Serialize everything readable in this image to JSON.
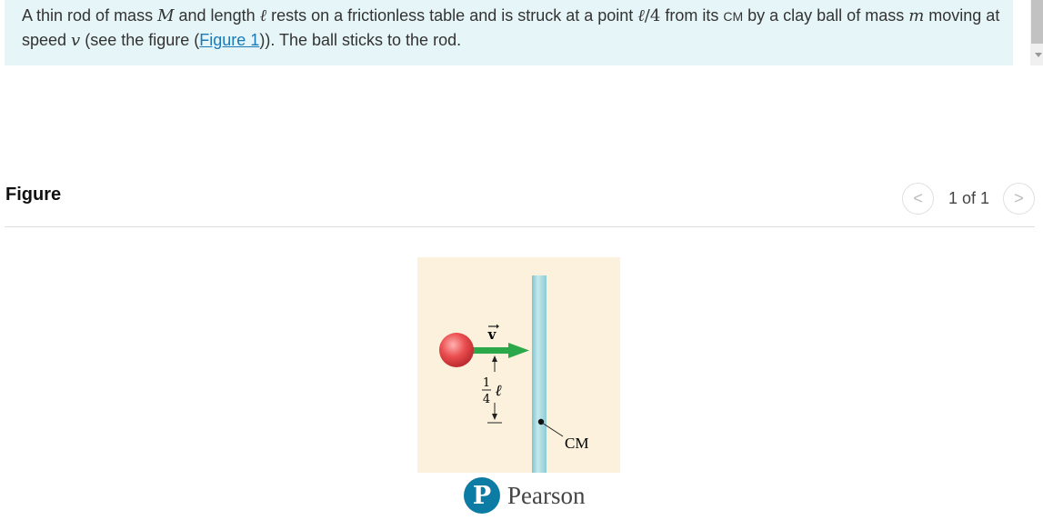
{
  "problem": {
    "parts": [
      {
        "t": "text",
        "v": "A thin rod of mass "
      },
      {
        "t": "math",
        "v": "M"
      },
      {
        "t": "text",
        "v": " and length "
      },
      {
        "t": "math",
        "v": "ℓ"
      },
      {
        "t": "text",
        "v": " rests on a frictionless table and is struck at a point "
      },
      {
        "t": "math",
        "v": "ℓ"
      },
      {
        "t": "mathup",
        "v": "/4"
      },
      {
        "t": "text",
        "v": " from its "
      },
      {
        "t": "small",
        "v": "CM"
      },
      {
        "t": "text",
        "v": " by a clay ball of mass "
      },
      {
        "t": "math",
        "v": "m"
      },
      {
        "t": "text",
        "v": " moving at speed "
      },
      {
        "t": "math",
        "v": "v"
      },
      {
        "t": "text",
        "v": " (see the figure ("
      },
      {
        "t": "link",
        "v": "Figure 1"
      },
      {
        "t": "text",
        "v": ")). The ball sticks to the rod."
      }
    ]
  },
  "figure_section": {
    "title": "Figure",
    "pager": {
      "prev_icon": "chevron-left-icon",
      "text": "1 of 1",
      "next_icon": "chevron-right-icon",
      "prev": "<",
      "next": ">"
    }
  },
  "figure": {
    "velocity_label": "v",
    "fraction_num": "1",
    "fraction_den": "4",
    "length_symbol": "ℓ",
    "cm_label": "CM",
    "colors": {
      "background": "#fbf1dc",
      "rod": "#a6d8df",
      "ball": "#e8474a",
      "arrow": "#2ba84a"
    }
  },
  "publisher": {
    "logo_letter": "P",
    "name": "Pearson",
    "color": "#0d7ca5"
  }
}
